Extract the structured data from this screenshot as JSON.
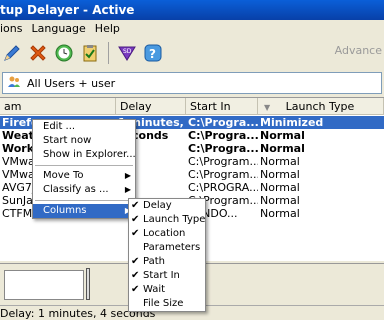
{
  "window": {
    "title": "tup Delayer - Active"
  },
  "menubar": {
    "items": [
      "ions",
      "Language",
      "Help"
    ]
  },
  "toolbar": {
    "advanced_label": "Advance",
    "icons": [
      "edit-pencil-icon",
      "delete-x-icon",
      "clock-icon",
      "clipboard-icon",
      "sd-filter-icon",
      "help-icon"
    ]
  },
  "userbar": {
    "label": "All Users + user"
  },
  "columns": [
    "am",
    "Delay",
    "Start In",
    "Launch Type"
  ],
  "rows": [
    {
      "name": "Firefox",
      "delay": "1 minutes, ...",
      "start_in": "C:\\Progra...",
      "launch": "Minimized",
      "bold": true,
      "selected": true
    },
    {
      "name": "Weath",
      "delay": "seconds",
      "start_in": "C:\\Progra...",
      "launch": "Normal",
      "bold": true
    },
    {
      "name": "WorkP",
      "delay": "",
      "start_in": "C:\\Progra...",
      "launch": "Normal",
      "bold": true
    },
    {
      "name": "VMwar",
      "delay": "",
      "start_in": "C:\\Program...",
      "launch": "Normal",
      "bold": false
    },
    {
      "name": "VMwar",
      "delay": "",
      "start_in": "C:\\Program...",
      "launch": "Normal",
      "bold": false
    },
    {
      "name": "AVG7_",
      "delay": "",
      "start_in": "C:\\PROGRA...",
      "launch": "Normal",
      "bold": false
    },
    {
      "name": "SunJav",
      "delay": "",
      "start_in": "C:\\Program...",
      "launch": "Normal",
      "bold": false
    },
    {
      "name": "CTFMO",
      "delay": "",
      "start_in": "WINDO...",
      "launch": "Normal",
      "bold": false
    }
  ],
  "context_menu": {
    "items": [
      {
        "label": "Edit ...",
        "type": "item"
      },
      {
        "label": "Start now",
        "type": "item"
      },
      {
        "label": "Show in Explorer...",
        "type": "item"
      },
      {
        "type": "sep"
      },
      {
        "label": "Move To",
        "type": "submenu"
      },
      {
        "label": "Classify as ...",
        "type": "submenu"
      },
      {
        "type": "sep"
      },
      {
        "label": "Columns",
        "type": "submenu",
        "highlighted": true
      }
    ]
  },
  "columns_submenu": {
    "items": [
      {
        "label": "Delay",
        "checked": true
      },
      {
        "label": "Launch Type",
        "checked": true
      },
      {
        "label": "Location",
        "checked": true
      },
      {
        "label": "Parameters",
        "checked": false
      },
      {
        "label": "Path",
        "checked": true
      },
      {
        "label": "Start In",
        "checked": true
      },
      {
        "label": "Wait",
        "checked": true
      },
      {
        "label": "File Size",
        "checked": false
      }
    ]
  },
  "statusbar": {
    "text": "Delay: 1 minutes, 4 seconds"
  },
  "colors": {
    "selection": "#316ac5",
    "titlebar": "#0a5fd8"
  }
}
